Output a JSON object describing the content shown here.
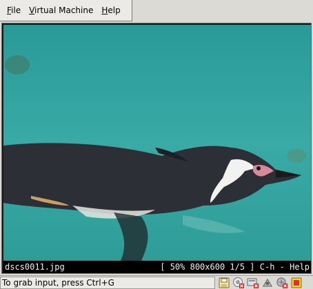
{
  "menu": {
    "file": {
      "mnemonic": "F",
      "rest": "ile"
    },
    "virtual_machine": {
      "mnemonic": "V",
      "rest": "irtual Machine"
    },
    "help": {
      "mnemonic": "H",
      "rest": "elp"
    }
  },
  "viewer": {
    "filename": "dscs0011.jpg",
    "info": "[ 50% 800x600 1/5 ] C-h - Help"
  },
  "statusbar": {
    "message": "To grab input, press Ctrl+G",
    "icons": [
      "floppy-icon",
      "cdrom-disconnected-icon",
      "disk-disconnected-icon",
      "network-icon",
      "network-disconnected-icon",
      "usb-icon"
    ]
  },
  "colors": {
    "water": "#38a8a5",
    "viewer_bar": "#000000",
    "chrome": "#dcdad5"
  }
}
